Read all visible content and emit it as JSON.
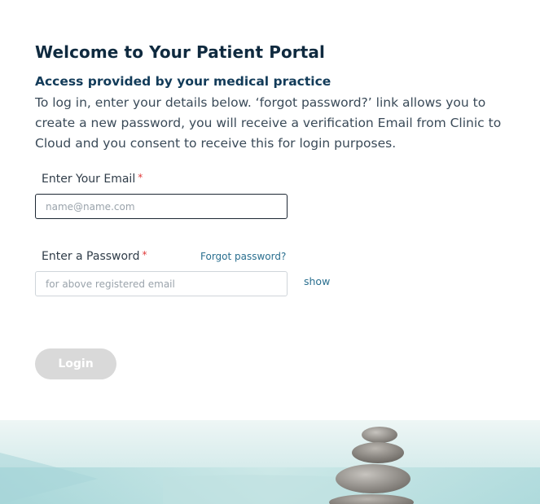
{
  "portal": {
    "title": "Welcome to Your Patient Portal",
    "subtitle": "Access provided by your medical practice",
    "intro": "To log in, enter your details below. ‘forgot password?’ link allows you to create a new password, you will receive a verification Email from Clinic to Cloud and you consent to receive this for login purposes."
  },
  "form": {
    "email": {
      "label": "Enter Your Email",
      "required_marker": "*",
      "placeholder": "name@name.com",
      "value": ""
    },
    "password": {
      "label": "Enter a Password",
      "required_marker": "*",
      "placeholder": "for above registered email",
      "value": "",
      "forgot_link": "Forgot password?",
      "show_toggle": "show"
    },
    "login_button": "Login"
  },
  "colors": {
    "heading": "#0f2a3f",
    "link": "#2a6f8f",
    "required": "#e03a3a",
    "button_disabled": "#d9d9d9"
  },
  "icons": {
    "hero": "stacked-stones-image"
  }
}
